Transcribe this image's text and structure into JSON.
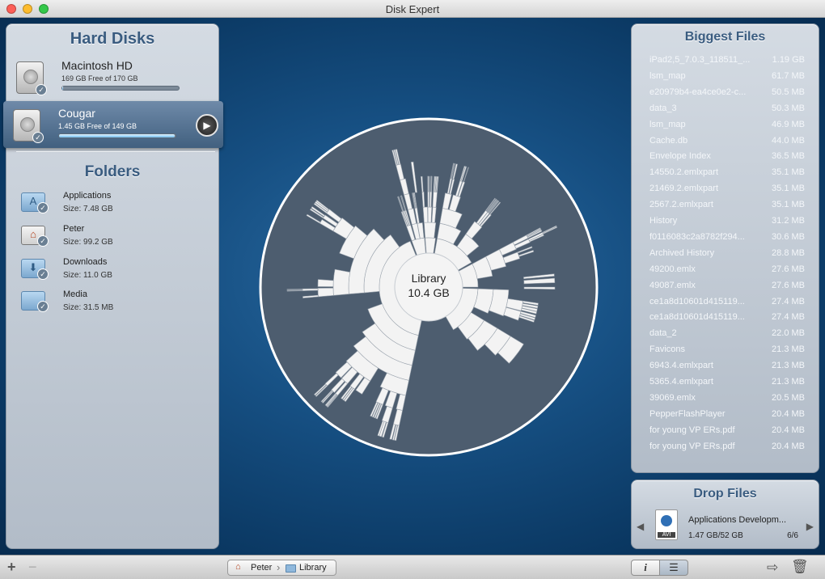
{
  "window": {
    "title": "Disk Expert"
  },
  "hard_disks": {
    "title": "Hard Disks",
    "items": [
      {
        "name": "Macintosh HD",
        "free": "169 GB Free of 170 GB",
        "used_fraction": 0.006
      },
      {
        "name": "Cougar",
        "free": "1.45 GB Free of 149 GB",
        "used_fraction": 0.99
      }
    ]
  },
  "folders": {
    "title": "Folders",
    "items": [
      {
        "name": "Applications",
        "size": "Size: 7.48 GB",
        "icon": "applications-folder-icon"
      },
      {
        "name": "Peter",
        "size": "Size: 99.2 GB",
        "icon": "home-folder-icon"
      },
      {
        "name": "Downloads",
        "size": "Size: 11.0 GB",
        "icon": "downloads-folder-icon"
      },
      {
        "name": "Media",
        "size": "Size: 31.5 MB",
        "icon": "folder-icon"
      }
    ]
  },
  "chart": {
    "center_label": "Library",
    "center_size": "10.4 GB"
  },
  "biggest_files": {
    "title": "Biggest Files",
    "items": [
      {
        "name": "iPad2,5_7.0.3_118511_...",
        "size": "1.19 GB"
      },
      {
        "name": "lsm_map",
        "size": "61.7 MB"
      },
      {
        "name": "e20979b4-ea4ce0e2-c...",
        "size": "50.5 MB"
      },
      {
        "name": "data_3",
        "size": "50.3 MB"
      },
      {
        "name": "lsm_map",
        "size": "46.9 MB"
      },
      {
        "name": "Cache.db",
        "size": "44.0 MB"
      },
      {
        "name": "Envelope Index",
        "size": "36.5 MB"
      },
      {
        "name": "14550.2.emlxpart",
        "size": "35.1 MB"
      },
      {
        "name": "21469.2.emlxpart",
        "size": "35.1 MB"
      },
      {
        "name": "2567.2.emlxpart",
        "size": "35.1 MB"
      },
      {
        "name": "History",
        "size": "31.2 MB"
      },
      {
        "name": "f0116083c2a8782f294...",
        "size": "30.6 MB"
      },
      {
        "name": "Archived History",
        "size": "28.8 MB"
      },
      {
        "name": "49200.emlx",
        "size": "27.6 MB"
      },
      {
        "name": "49087.emlx",
        "size": "27.6 MB"
      },
      {
        "name": "ce1a8d10601d415119...",
        "size": "27.4 MB"
      },
      {
        "name": "ce1a8d10601d415119...",
        "size": "27.4 MB"
      },
      {
        "name": "data_2",
        "size": "22.0 MB"
      },
      {
        "name": "Favicons",
        "size": "21.3 MB"
      },
      {
        "name": "6943.4.emlxpart",
        "size": "21.3 MB"
      },
      {
        "name": "5365.4.emlxpart",
        "size": "21.3 MB"
      },
      {
        "name": "39069.emlx",
        "size": "20.5 MB"
      },
      {
        "name": "PepperFlashPlayer",
        "size": "20.4 MB"
      },
      {
        "name": "for young VP ERs.pdf",
        "size": "20.4 MB"
      },
      {
        "name": "for young VP ERs.pdf",
        "size": "20.4 MB"
      }
    ]
  },
  "drop_files": {
    "title": "Drop Files",
    "file_name": "Applications Developm...",
    "file_size": "1.47 GB/52 GB",
    "counter": "6/6",
    "file_icon_label": "AVI"
  },
  "breadcrumb": {
    "items": [
      "Peter",
      "Library"
    ]
  }
}
